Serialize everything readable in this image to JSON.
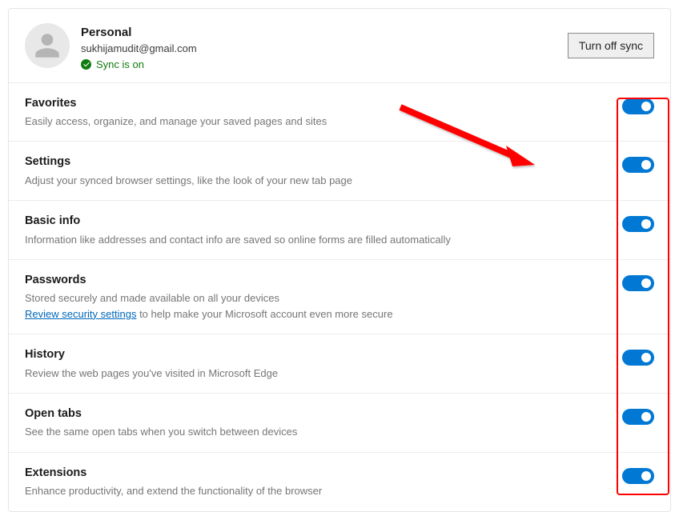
{
  "profile": {
    "name": "Personal",
    "email": "sukhijamudit@gmail.com",
    "sync_status": "Sync is on"
  },
  "actions": {
    "turn_off_sync": "Turn off sync"
  },
  "settings": [
    {
      "id": "favorites",
      "title": "Favorites",
      "description": "Easily access, organize, and manage your saved pages and sites",
      "enabled": true
    },
    {
      "id": "settings",
      "title": "Settings",
      "description": "Adjust your synced browser settings, like the look of your new tab page",
      "enabled": true
    },
    {
      "id": "basic-info",
      "title": "Basic info",
      "description": "Information like addresses and contact info are saved so online forms are filled automatically",
      "enabled": true
    },
    {
      "id": "passwords",
      "title": "Passwords",
      "description_pre": "Stored securely and made available on all your devices",
      "link_text": "Review security settings",
      "description_post": " to help make your Microsoft account even more secure",
      "enabled": true
    },
    {
      "id": "history",
      "title": "History",
      "description": "Review the web pages you've visited in Microsoft Edge",
      "enabled": true
    },
    {
      "id": "open-tabs",
      "title": "Open tabs",
      "description": "See the same open tabs when you switch between devices",
      "enabled": true
    },
    {
      "id": "extensions",
      "title": "Extensions",
      "description": "Enhance productivity, and extend the functionality of the browser",
      "enabled": true
    }
  ],
  "annotation": {
    "arrow_color": "#ff0000",
    "highlight_color": "#ff0000"
  }
}
